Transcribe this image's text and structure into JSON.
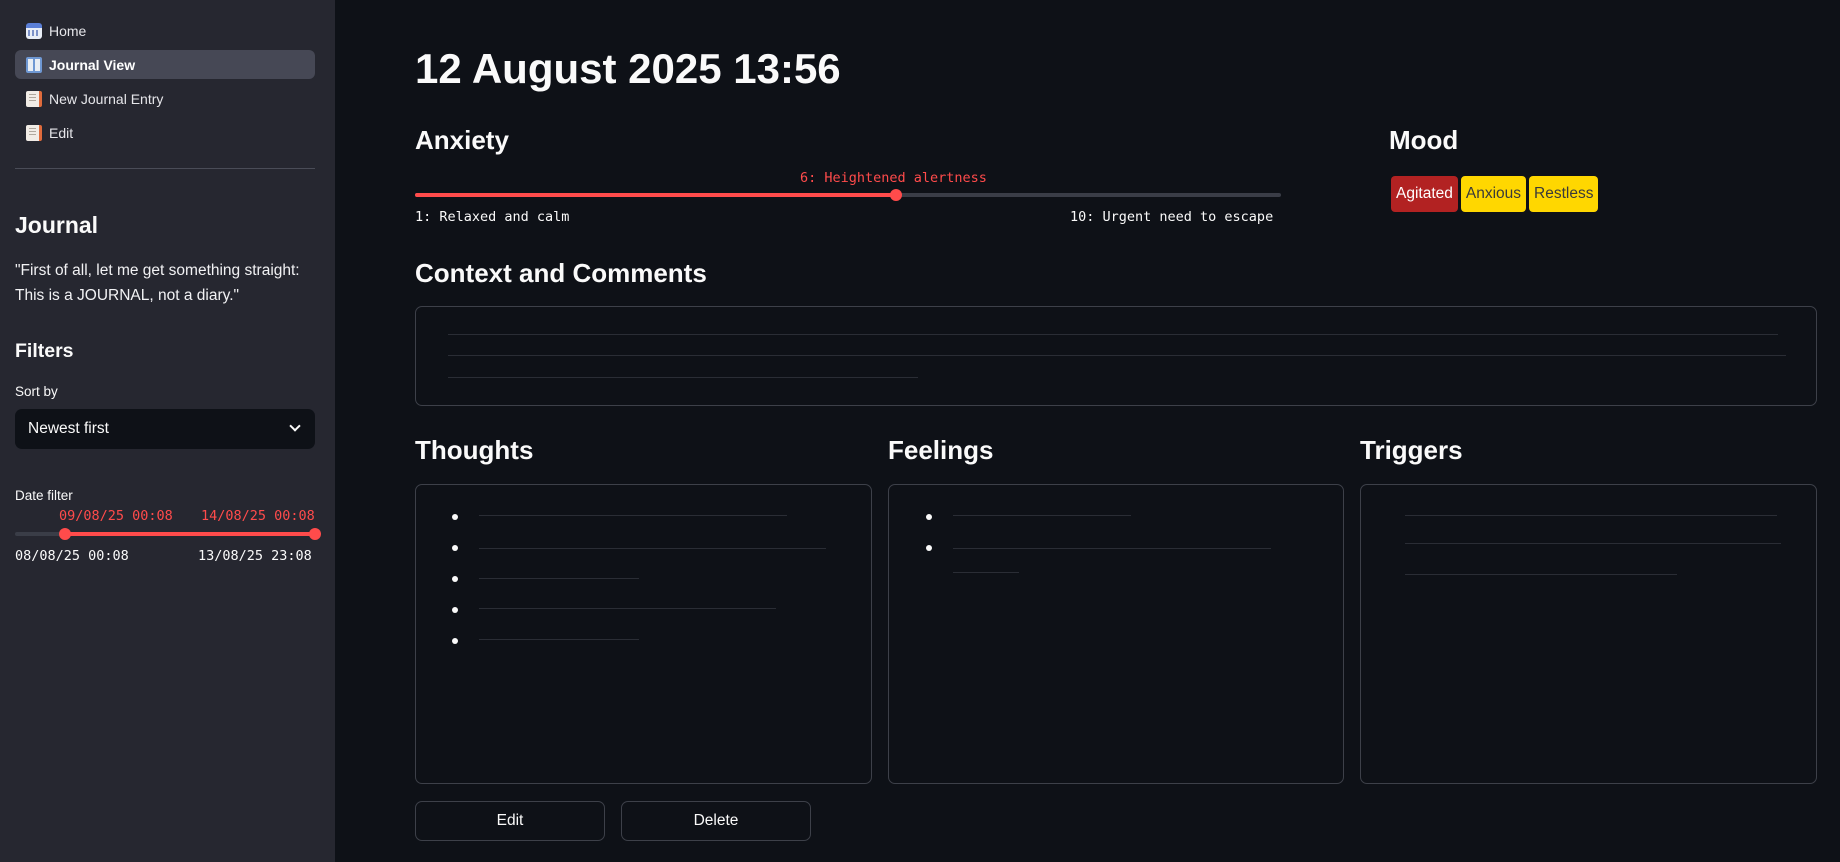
{
  "nav": {
    "items": [
      {
        "label": "Home",
        "icon": "calendar-icon",
        "active": false
      },
      {
        "label": "Journal View",
        "icon": "book-icon",
        "active": true
      },
      {
        "label": "New Journal Entry",
        "icon": "document-icon",
        "active": false
      },
      {
        "label": "Edit",
        "icon": "document-icon",
        "active": false
      }
    ]
  },
  "sidebar": {
    "journal_heading": "Journal",
    "quote": "\"First of all, let me get something straight: This is a JOURNAL, not a diary.\"",
    "filters_heading": "Filters",
    "sort_label": "Sort by",
    "sort_value": "Newest first",
    "date_filter_label": "Date filter",
    "date_selected_start": "09/08/25 00:08",
    "date_selected_end": "14/08/25 00:08",
    "date_min": "08/08/25 00:08",
    "date_max": "13/08/25 23:08",
    "date_range_selected_fraction": [
      0.167,
      1.0
    ]
  },
  "entry": {
    "title": "12 August 2025 13:56",
    "anxiety_heading": "Anxiety",
    "anxiety_value_label": "6: Heightened alertness",
    "anxiety_value": 6,
    "anxiety_min": 1,
    "anxiety_max": 10,
    "anxiety_min_label": "1: Relaxed and calm",
    "anxiety_max_label": "10: Urgent need to escape",
    "mood_heading": "Mood",
    "moods": [
      {
        "label": "Agitated",
        "color": "#b22222",
        "text_color": "#ffffff"
      },
      {
        "label": "Anxious",
        "color": "#ffd700",
        "text_color": "#3a3a3a"
      },
      {
        "label": "Restless",
        "color": "#ffd700",
        "text_color": "#3a3a3a"
      }
    ],
    "context_heading": "Context and Comments",
    "thoughts_heading": "Thoughts",
    "feelings_heading": "Feelings",
    "triggers_heading": "Triggers",
    "edit_label": "Edit",
    "delete_label": "Delete"
  },
  "colors": {
    "accent": "#ff4b4b",
    "background": "#0e1117",
    "sidebar": "#262730"
  }
}
